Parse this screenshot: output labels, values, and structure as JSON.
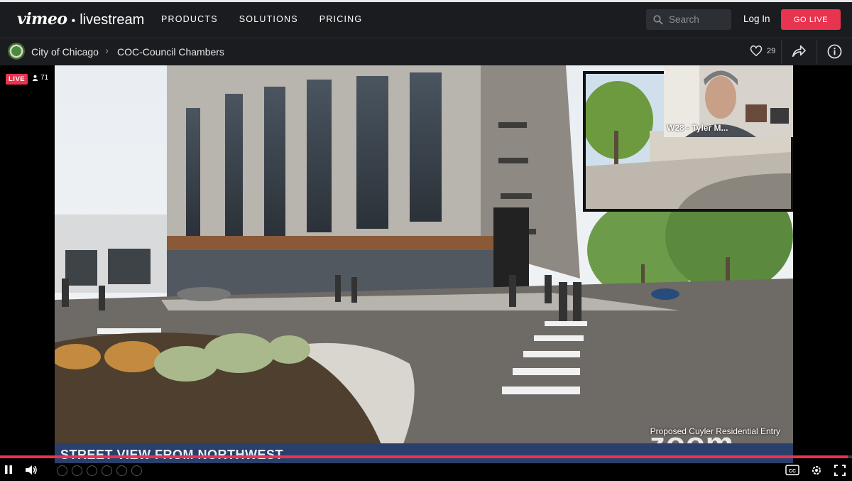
{
  "header": {
    "brand_vimeo": "vimeo",
    "brand_dot": "•",
    "brand_livestream": "livestream",
    "nav": [
      "PRODUCTS",
      "SOLUTIONS",
      "PRICING"
    ],
    "search_placeholder": "Search",
    "login_label": "Log In",
    "golive_label": "GO LIVE",
    "accent_color": "#e8344e"
  },
  "breadcrumb": {
    "account": "City of Chicago",
    "separator": ">",
    "event": "COC-Council Chambers"
  },
  "actions": {
    "likes_count": "29",
    "icons": [
      "heart-icon",
      "share-icon",
      "info-icon"
    ]
  },
  "player": {
    "live_badge": "LIVE",
    "viewer_count": "71",
    "participant_label": "W28 - Tyler M...",
    "caption_right": "Proposed Cuyler Residential Entry",
    "zoom_watermark": "zoom",
    "lower_third": "STREET VIEW FROM NORTHWEST",
    "progress_fraction": 0.995
  }
}
